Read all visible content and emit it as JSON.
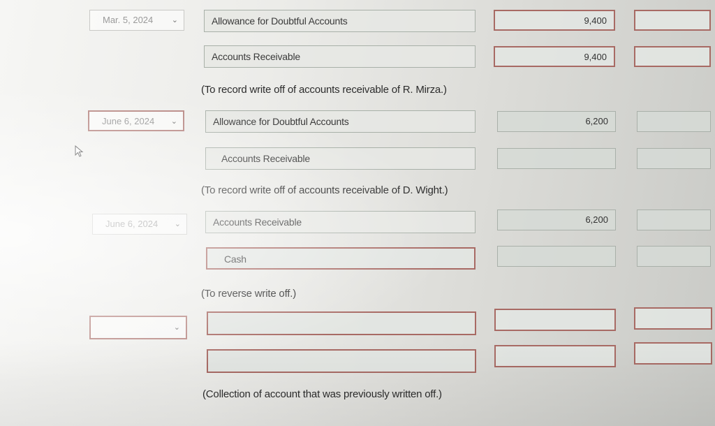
{
  "entries": [
    {
      "date": "Mar. 5, 2024",
      "lines": [
        {
          "account": "Allowance for Doubtful Accounts",
          "debit": "9,400",
          "credit": ""
        },
        {
          "account": "Accounts Receivable",
          "debit": "",
          "credit": "9,400"
        }
      ],
      "memo": "(To record write off of accounts receivable of R. Mirza.)"
    },
    {
      "date": "June 6, 2024",
      "lines": [
        {
          "account": "Allowance for Doubtful Accounts",
          "debit": "6,200",
          "credit": ""
        },
        {
          "account": "Accounts Receivable",
          "debit": "",
          "credit": ""
        }
      ],
      "memo": "(To record write off of accounts receivable of D. Wight.)"
    },
    {
      "date": "June 6, 2024",
      "lines": [
        {
          "account": "Accounts Receivable",
          "debit": "6,200",
          "credit": ""
        },
        {
          "account": "Cash",
          "debit": "",
          "credit": ""
        }
      ],
      "memo": "(To reverse write off.)"
    },
    {
      "date": "",
      "lines": [
        {
          "account": "",
          "debit": "",
          "credit": ""
        },
        {
          "account": "",
          "debit": "",
          "credit": ""
        }
      ],
      "memo": "(Collection of account that was previously written off.)"
    }
  ],
  "icons": {
    "chevron": "chevron-down-icon",
    "cursor": "mouse-pointer-icon"
  }
}
